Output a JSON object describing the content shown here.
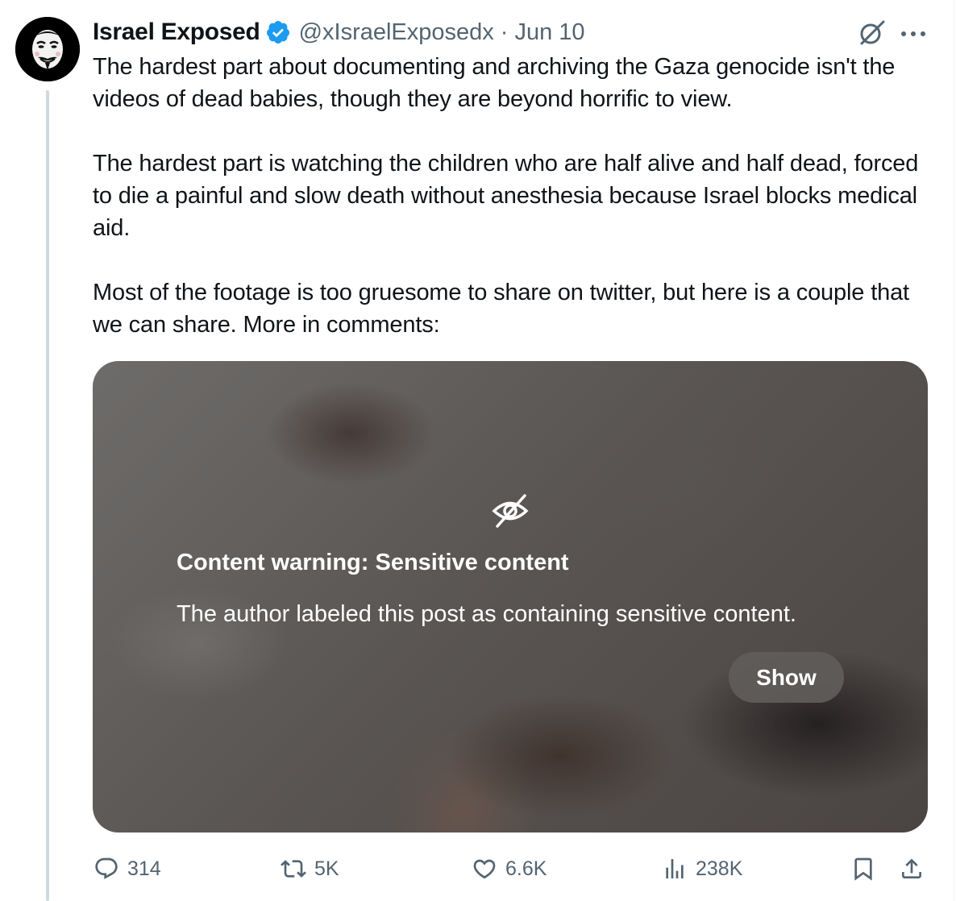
{
  "colors": {
    "text": "#0f1419",
    "secondary": "#536471",
    "verified": "#1d9bf0",
    "thread_line": "#cfd9de"
  },
  "author": {
    "display_name": "Israel Exposed",
    "handle": "@xIsraelExposedx",
    "separator": "·",
    "date": "Jun 10",
    "verified_icon": "verified-badge-icon",
    "avatar_icon": "guy-fawkes-mask-avatar"
  },
  "tweet": {
    "paragraphs": [
      "The hardest part about documenting and archiving the Gaza genocide isn't the videos of dead babies, though they are beyond horrific to view.",
      "The hardest part is watching the children who are half alive and half dead, forced to die a painful and slow death without anesthesia because Israel blocks medical aid.",
      "Most of the footage is too gruesome to share on twitter, but here is a couple that we can share. More in comments:"
    ]
  },
  "media": {
    "warning_icon": "eye-slash-icon",
    "warning_title": "Content warning: Sensitive content",
    "warning_text": "The author labeled this post as containing sensitive content.",
    "show_label": "Show"
  },
  "actions": {
    "replies": "314",
    "reposts": "5K",
    "likes": "6.6K",
    "views": "238K",
    "icons": [
      "reply-icon",
      "repost-icon",
      "like-icon",
      "views-icon",
      "bookmark-icon",
      "share-icon"
    ]
  }
}
